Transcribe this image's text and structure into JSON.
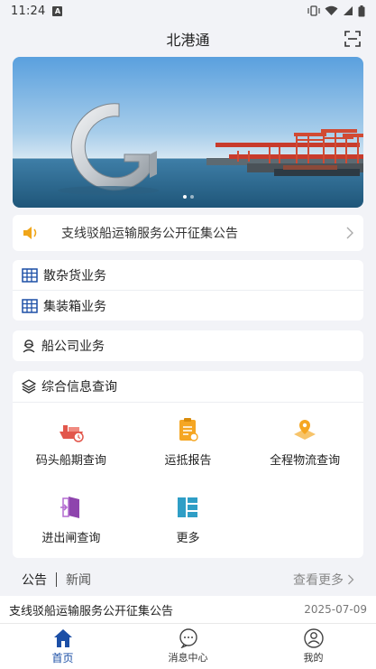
{
  "status_bar": {
    "time": "11:24",
    "notif_badge": "A"
  },
  "header": {
    "title": "北港通"
  },
  "notice": {
    "text": "支线驳船运输服务公开征集公告"
  },
  "business": [
    {
      "label": "散杂货业务",
      "icon": "grid-icon"
    },
    {
      "label": "集装箱业务",
      "icon": "grid-icon"
    }
  ],
  "shipping": {
    "label": "船公司业务",
    "icon": "person-icon"
  },
  "info_query": {
    "title": "综合信息查询",
    "items": [
      {
        "label": "码头船期查询",
        "icon": "ship-icon"
      },
      {
        "label": "运抵报告",
        "icon": "report-icon"
      },
      {
        "label": "全程物流查询",
        "icon": "location-icon"
      },
      {
        "label": "进出闸查询",
        "icon": "gate-icon"
      },
      {
        "label": "更多",
        "icon": "more-icon"
      }
    ]
  },
  "news": {
    "tabs": [
      "公告",
      "新闻"
    ],
    "more_label": "查看更多",
    "items": [
      {
        "title": "支线驳船运输服务公开征集公告",
        "date": "2025-07-09"
      }
    ]
  },
  "tabbar": [
    {
      "label": "首页",
      "icon": "home-icon",
      "active": true
    },
    {
      "label": "消息中心",
      "icon": "message-icon",
      "active": false
    },
    {
      "label": "我的",
      "icon": "profile-icon",
      "active": false
    }
  ],
  "colors": {
    "accent": "#1c4fa6",
    "background": "#f2f3f7"
  }
}
